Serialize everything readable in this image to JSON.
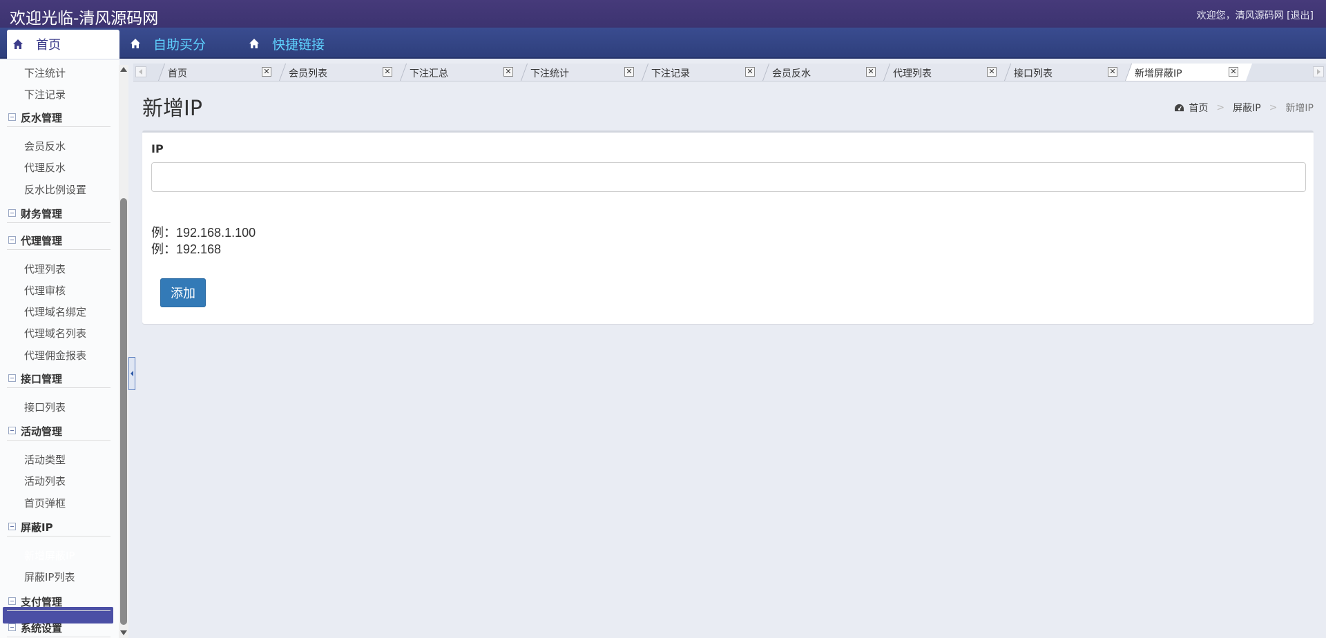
{
  "header": {
    "site_title": "欢迎光临-清风源码网",
    "welcome": "欢迎您，清风源码网",
    "logout": "[退出]"
  },
  "nav": {
    "home": "首页",
    "items": [
      "自助买分",
      "快捷链接"
    ]
  },
  "sidebar": {
    "items": [
      {
        "type": "sub",
        "label": "下注统计"
      },
      {
        "type": "sub",
        "label": "下注记录"
      },
      {
        "type": "group",
        "label": "反水管理"
      },
      {
        "type": "sub",
        "label": "会员反水"
      },
      {
        "type": "sub",
        "label": "代理反水"
      },
      {
        "type": "sub",
        "label": "反水比例设置"
      },
      {
        "type": "group",
        "label": "财务管理"
      },
      {
        "type": "group",
        "label": "代理管理"
      },
      {
        "type": "sub",
        "label": "代理列表"
      },
      {
        "type": "sub",
        "label": "代理审核"
      },
      {
        "type": "sub",
        "label": "代理域名绑定"
      },
      {
        "type": "sub",
        "label": "代理域名列表"
      },
      {
        "type": "sub",
        "label": "代理佣金报表"
      },
      {
        "type": "group",
        "label": "接口管理"
      },
      {
        "type": "sub",
        "label": "接口列表"
      },
      {
        "type": "group",
        "label": "活动管理"
      },
      {
        "type": "sub",
        "label": "活动类型"
      },
      {
        "type": "sub",
        "label": "活动列表"
      },
      {
        "type": "sub",
        "label": "首页弹框"
      },
      {
        "type": "group",
        "label": "屏蔽IP"
      },
      {
        "type": "sub",
        "label": "新增屏蔽IP",
        "active": true
      },
      {
        "type": "sub",
        "label": "屏蔽IP列表"
      },
      {
        "type": "group",
        "label": "支付管理"
      },
      {
        "type": "group",
        "label": "系统设置"
      }
    ]
  },
  "tabs": [
    {
      "label": "首页"
    },
    {
      "label": "会员列表"
    },
    {
      "label": "下注汇总"
    },
    {
      "label": "下注统计"
    },
    {
      "label": "下注记录"
    },
    {
      "label": "会员反水"
    },
    {
      "label": "代理列表"
    },
    {
      "label": "接口列表"
    },
    {
      "label": "新增屏蔽IP",
      "active": true
    }
  ],
  "tab_close_glyph": "✕",
  "page": {
    "title": "新增IP",
    "breadcrumb": [
      "首页",
      "屏蔽IP",
      "新增IP"
    ],
    "breadcrumb_sep": ">"
  },
  "form": {
    "ip_label": "IP",
    "ip_value": "",
    "examples": [
      "例：192.168.1.100",
      "例：192.168"
    ],
    "submit_label": "添加"
  },
  "icons": {
    "home": "home-icon",
    "dashboard": "dashboard-icon"
  },
  "colors": {
    "topbar": "#3c3370",
    "navbar": "#34468a",
    "nav_link": "#5fd2ff",
    "active_menu": "#4b4fa5",
    "primary_button": "#337ab7"
  }
}
